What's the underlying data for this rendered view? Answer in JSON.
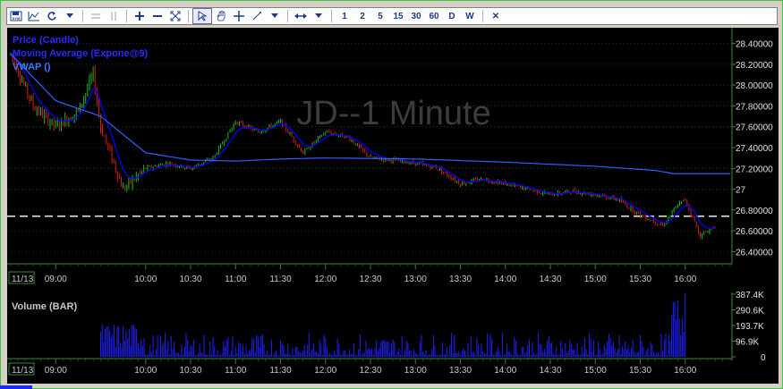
{
  "toolbar": {
    "bar_buttons": [
      "1",
      "2",
      "5",
      "15",
      "30",
      "60",
      "D",
      "W"
    ],
    "close_glyph": "✕"
  },
  "chart": {
    "watermark": "JD--1 Minute",
    "legend": [
      {
        "text": "Price (Candle)",
        "color": "#2a2aff"
      },
      {
        "text": "Moving Average (Expone@9)",
        "color": "#2a2aff"
      },
      {
        "text": "VWAP ()",
        "color": "#3a7aff"
      }
    ],
    "volume_label": "Volume (BAR)",
    "date_label": "11/13",
    "x_labels": [
      "09:00",
      "10:00",
      "10:30",
      "11:00",
      "11:30",
      "12:00",
      "12:30",
      "13:00",
      "13:30",
      "14:00",
      "14:30",
      "15:00",
      "15:30",
      "16:00"
    ],
    "price_labels": [
      "28.40000",
      "28.20000",
      "28.00000",
      "27.80000",
      "27.60000",
      "27.40000",
      "27.20000",
      "27",
      "26.80000",
      "26.60000",
      "26.40000"
    ],
    "volume_labels": [
      "387.4K",
      "290.6K",
      "193.7K",
      "96.9K",
      "0"
    ],
    "reference_line": 26.74,
    "colors": {
      "up": "#18c018",
      "down": "#e01818",
      "ema": "#0000ff",
      "vwap": "#3060ff",
      "volume": "#2020ff",
      "grid": "#1a6a1a"
    }
  },
  "chart_data": {
    "type": "candlestick",
    "symbol": "JD",
    "interval": "1 Minute",
    "x_ticks": [
      "09:00",
      "10:00",
      "10:30",
      "11:00",
      "11:30",
      "12:00",
      "12:30",
      "13:00",
      "13:30",
      "14:00",
      "14:30",
      "15:00",
      "15:30",
      "16:00"
    ],
    "price_range": [
      26.3,
      28.5
    ],
    "volume_range": [
      0,
      387400
    ],
    "price_path": [
      {
        "t": "08:30",
        "p": 28.3
      },
      {
        "t": "08:45",
        "p": 27.8
      },
      {
        "t": "09:00",
        "p": 27.6
      },
      {
        "t": "09:15",
        "p": 27.75
      },
      {
        "t": "09:25",
        "p": 28.1
      },
      {
        "t": "09:30",
        "p": 27.6
      },
      {
        "t": "09:45",
        "p": 27.0
      },
      {
        "t": "10:00",
        "p": 27.2
      },
      {
        "t": "10:15",
        "p": 27.25
      },
      {
        "t": "10:30",
        "p": 27.2
      },
      {
        "t": "10:45",
        "p": 27.3
      },
      {
        "t": "11:00",
        "p": 27.65
      },
      {
        "t": "11:15",
        "p": 27.55
      },
      {
        "t": "11:30",
        "p": 27.65
      },
      {
        "t": "11:45",
        "p": 27.35
      },
      {
        "t": "12:00",
        "p": 27.55
      },
      {
        "t": "12:15",
        "p": 27.5
      },
      {
        "t": "12:30",
        "p": 27.3
      },
      {
        "t": "12:45",
        "p": 27.28
      },
      {
        "t": "13:00",
        "p": 27.25
      },
      {
        "t": "13:15",
        "p": 27.2
      },
      {
        "t": "13:30",
        "p": 27.05
      },
      {
        "t": "13:45",
        "p": 27.1
      },
      {
        "t": "14:00",
        "p": 27.05
      },
      {
        "t": "14:15",
        "p": 27.0
      },
      {
        "t": "14:30",
        "p": 26.95
      },
      {
        "t": "14:45",
        "p": 26.98
      },
      {
        "t": "15:00",
        "p": 26.95
      },
      {
        "t": "15:15",
        "p": 26.9
      },
      {
        "t": "15:30",
        "p": 26.75
      },
      {
        "t": "15:45",
        "p": 26.65
      },
      {
        "t": "15:55",
        "p": 26.85
      },
      {
        "t": "16:00",
        "p": 26.9
      },
      {
        "t": "16:10",
        "p": 26.55
      },
      {
        "t": "16:20",
        "p": 26.65
      }
    ],
    "vwap_path": [
      {
        "t": "08:30",
        "p": 28.3
      },
      {
        "t": "09:00",
        "p": 27.85
      },
      {
        "t": "09:30",
        "p": 27.7
      },
      {
        "t": "10:00",
        "p": 27.35
      },
      {
        "t": "10:30",
        "p": 27.28
      },
      {
        "t": "11:00",
        "p": 27.27
      },
      {
        "t": "11:30",
        "p": 27.29
      },
      {
        "t": "12:00",
        "p": 27.3
      },
      {
        "t": "13:00",
        "p": 27.29
      },
      {
        "t": "14:00",
        "p": 27.26
      },
      {
        "t": "15:00",
        "p": 27.22
      },
      {
        "t": "15:40",
        "p": 27.18
      },
      {
        "t": "15:52",
        "p": 27.15
      },
      {
        "t": "16:30",
        "p": 27.15
      }
    ]
  }
}
